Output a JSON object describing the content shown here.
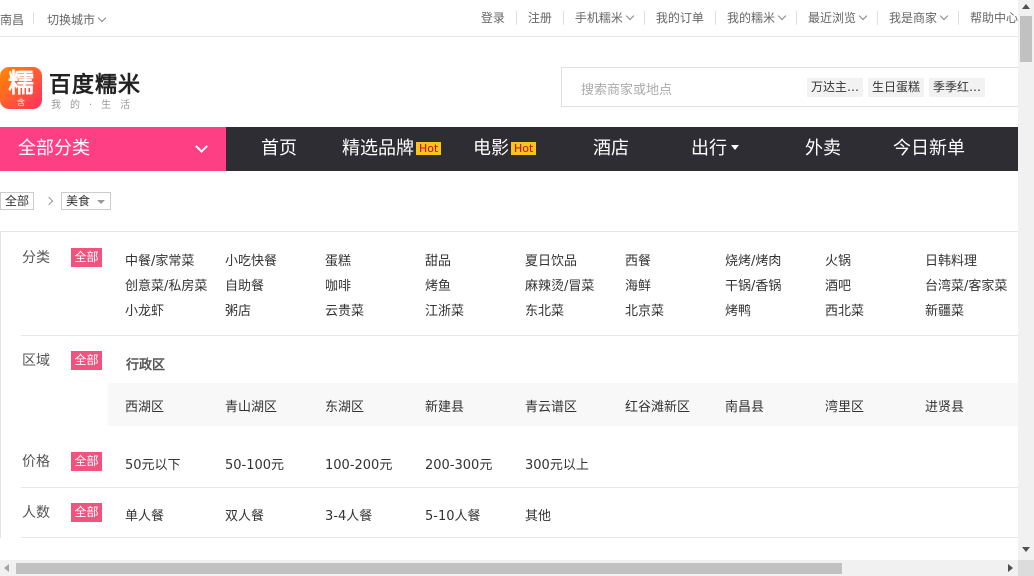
{
  "topbar": {
    "city": "南昌",
    "switch_city": "切换城市",
    "links": [
      "登录",
      "注册",
      "手机糯米",
      "我的订单",
      "我的糯米",
      "最近浏览",
      "我是商家",
      "帮助中心"
    ]
  },
  "logo": {
    "glyph": "糯",
    "badge": "含",
    "name": "百度糯米",
    "slogan": "我的·生活"
  },
  "search": {
    "placeholder": "搜索商家或地点",
    "hot_tags": [
      "万达主…",
      "生日蛋糕",
      "季季红…"
    ]
  },
  "nav": {
    "all_categories": "全部分类",
    "items": [
      "首页",
      "精选品牌",
      "电影",
      "酒店",
      "出行",
      "外卖",
      "今日新单"
    ],
    "hot_badge": "Hot"
  },
  "breadcrumb": {
    "all": "全部",
    "current": "美食"
  },
  "filter": {
    "all_badge": "全部",
    "category": {
      "label": "分类",
      "options": [
        "中餐/家常菜",
        "小吃快餐",
        "蛋糕",
        "甜品",
        "夏日饮品",
        "西餐",
        "烧烤/烤肉",
        "火锅",
        "日韩料理",
        "创意菜/私房菜",
        "自助餐",
        "咖啡",
        "烤鱼",
        "麻辣烫/冒菜",
        "海鲜",
        "干锅/香锅",
        "酒吧",
        "台湾菜/客家菜",
        "小龙虾",
        "粥店",
        "云贵菜",
        "江浙菜",
        "东北菜",
        "北京菜",
        "烤鸭",
        "西北菜",
        "新疆菜"
      ]
    },
    "area": {
      "label": "区域",
      "subhead": "行政区",
      "options": [
        "西湖区",
        "青山湖区",
        "东湖区",
        "新建县",
        "青云谱区",
        "红谷滩新区",
        "南昌县",
        "湾里区",
        "进贤县"
      ]
    },
    "price": {
      "label": "价格",
      "options": [
        "50元以下",
        "50-100元",
        "100-200元",
        "200-300元",
        "300元以上"
      ]
    },
    "people": {
      "label": "人数",
      "options": [
        "单人餐",
        "双人餐",
        "3-4人餐",
        "5-10人餐",
        "其他"
      ]
    }
  },
  "colors": {
    "brand_pink": "#ff3f84",
    "nav_dark": "#2d2d33",
    "badge_pink": "#f0537e",
    "hot_yellow": "#f7c51e"
  }
}
